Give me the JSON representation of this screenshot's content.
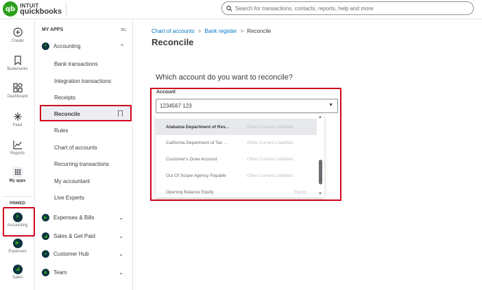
{
  "brand": {
    "intuit": "INTUIT",
    "name": "quickbooks",
    "logo_mark": "qb"
  },
  "search": {
    "placeholder": "Search for transactions, contacts, reports, help and more"
  },
  "rail": {
    "items": [
      {
        "label": "Create",
        "icon": "plus-circle-icon"
      },
      {
        "label": "Bookmarks",
        "icon": "bookmark-icon"
      },
      {
        "label": "Dashboard",
        "icon": "dashboard-icon"
      },
      {
        "label": "Feed",
        "icon": "sparkle-icon"
      },
      {
        "label": "Reports",
        "icon": "chart-icon"
      },
      {
        "label": "My apps",
        "icon": "grid-icon"
      }
    ],
    "pinned_label": "PINNED",
    "pinned": [
      {
        "label": "Accounting"
      },
      {
        "label": "Expenses"
      },
      {
        "label": "Sales"
      }
    ]
  },
  "menu": {
    "header": "MY APPS",
    "accounting": {
      "label": "Accounting",
      "items": [
        "Bank transactions",
        "Integration transactions",
        "Receipts",
        "Reconcile",
        "Rules",
        "Chart of accounts",
        "Recurring transactions",
        "My accountant",
        "Live Experts"
      ]
    },
    "groups": [
      "Expenses & Bills",
      "Sales & Get Paid",
      "Customer Hub",
      "Team"
    ]
  },
  "breadcrumb": {
    "link1": "Chart of accounts",
    "link2": "Bank register",
    "current": "Reconcile",
    "sep": ">"
  },
  "page": {
    "title": "Reconcile",
    "question": "Which account do you want to reconcile?"
  },
  "account": {
    "label": "Account",
    "value": "1234567 123",
    "options": [
      {
        "name": "Alabama Department of Rev...",
        "type": "Other Current Liabilities"
      },
      {
        "name": "California Department of Tax ...",
        "type": "Other Current Liabilities"
      },
      {
        "name": "Customer's Draw Account",
        "type": "Other Current Liabilities"
      },
      {
        "name": "Out Of Scope Agency Payable",
        "type": "Other Current Liabilities"
      },
      {
        "name": "Opening Balance Equity",
        "type": "Equity"
      }
    ]
  },
  "colors": {
    "brand_green": "#2ca01c",
    "link_blue": "#0077c5",
    "highlight_red": "#d0021b",
    "dark_navy": "#0d333f"
  }
}
